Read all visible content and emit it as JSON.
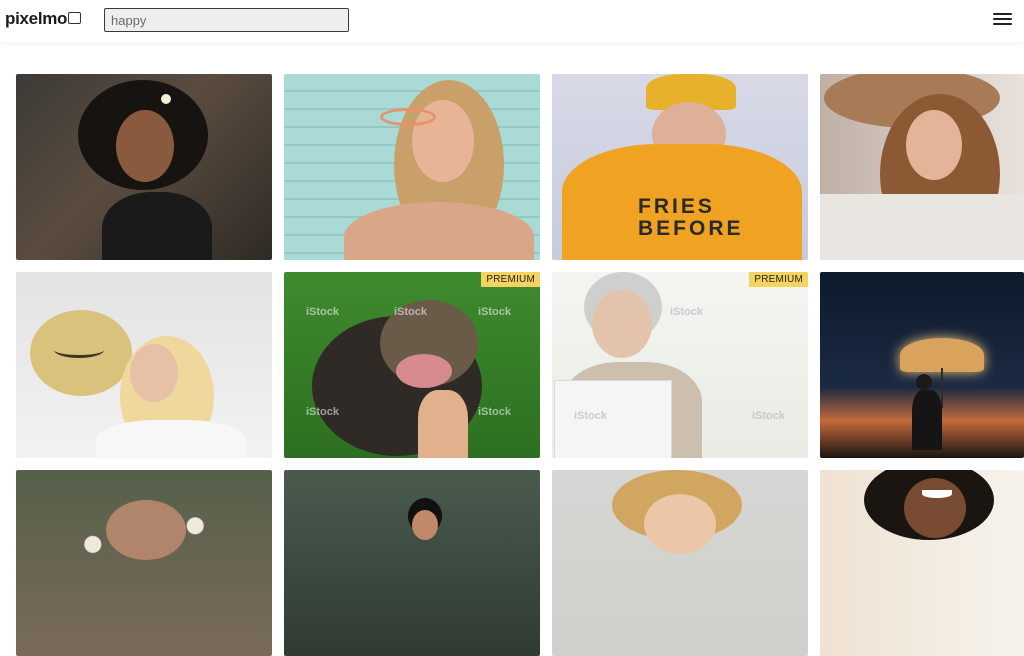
{
  "header": {
    "logo_text": "pixelmo",
    "search": {
      "value": "happy",
      "placeholder": ""
    },
    "menu_icon": "hamburger-icon"
  },
  "colors": {
    "premium_badge": "#f4d35e",
    "search_bg": "#eeeeee",
    "page_bg": "#ffffff"
  },
  "gallery": {
    "items": [
      {
        "id": "woman-curly-hair-laughing",
        "premium": false
      },
      {
        "id": "woman-sunglasses-laughing",
        "premium": false
      },
      {
        "id": "woman-yellow-hoodie-beanie",
        "premium": false,
        "shirt_text": "FRIES BEFORE"
      },
      {
        "id": "woman-straw-hat",
        "premium": false
      },
      {
        "id": "woman-smiley-balloon",
        "premium": false
      },
      {
        "id": "dog-being-petted",
        "premium": true,
        "badge": "PREMIUM",
        "watermark": "iStock"
      },
      {
        "id": "senior-woman-laptop",
        "premium": true,
        "badge": "PREMIUM",
        "watermark": "iStock"
      },
      {
        "id": "person-light-umbrella-night",
        "premium": false
      },
      {
        "id": "flowers-row3",
        "premium": false
      },
      {
        "id": "boy-forest-row3",
        "premium": false
      },
      {
        "id": "girl-blonde-row3",
        "premium": false
      },
      {
        "id": "woman-smiling-row3",
        "premium": false
      }
    ]
  }
}
